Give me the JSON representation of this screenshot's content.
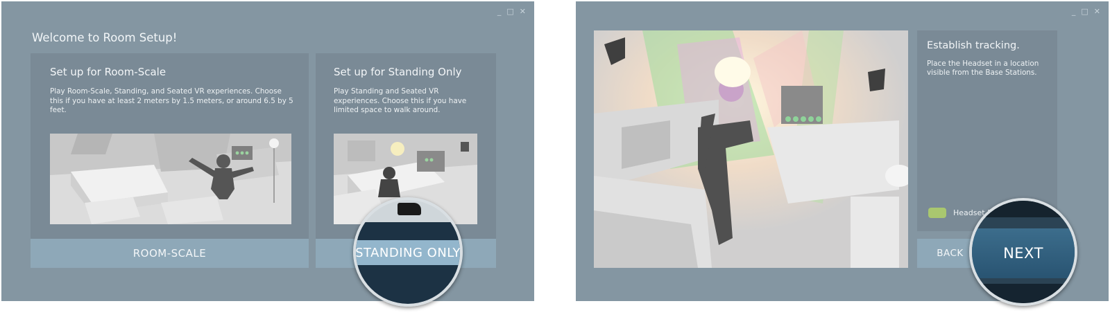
{
  "left_window": {
    "title": "Welcome to Room Setup!",
    "controls": [
      "_",
      "□",
      "✕"
    ],
    "room_scale": {
      "heading": "Set up for Room-Scale",
      "description": "Play Room-Scale, Standing, and Seated VR experiences. Choose this if you have at least 2 meters by 1.5 meters, or around 6.5 by 5 feet.",
      "button_label": "ROOM-SCALE"
    },
    "standing": {
      "heading": "Set up for Standing Only",
      "description": "Play Standing and Seated VR experiences. Choose this if you have limited space to walk around.",
      "button_label": "STANDING ONLY"
    }
  },
  "right_window": {
    "controls": [
      "_",
      "□",
      "✕"
    ],
    "panel_title": "Establish tracking.",
    "panel_text": "Place the Headset in a location visible from the Base Stations.",
    "status_label": "Headset D",
    "back_label": "BACK",
    "next_label": "NEXT"
  },
  "colors": {
    "window_bg": "#8496a2",
    "card_bg": "#7a8a96",
    "button_bg": "#8ea8b8",
    "next_blue": "#2f5e7c",
    "status_green": "#a9c76f"
  }
}
